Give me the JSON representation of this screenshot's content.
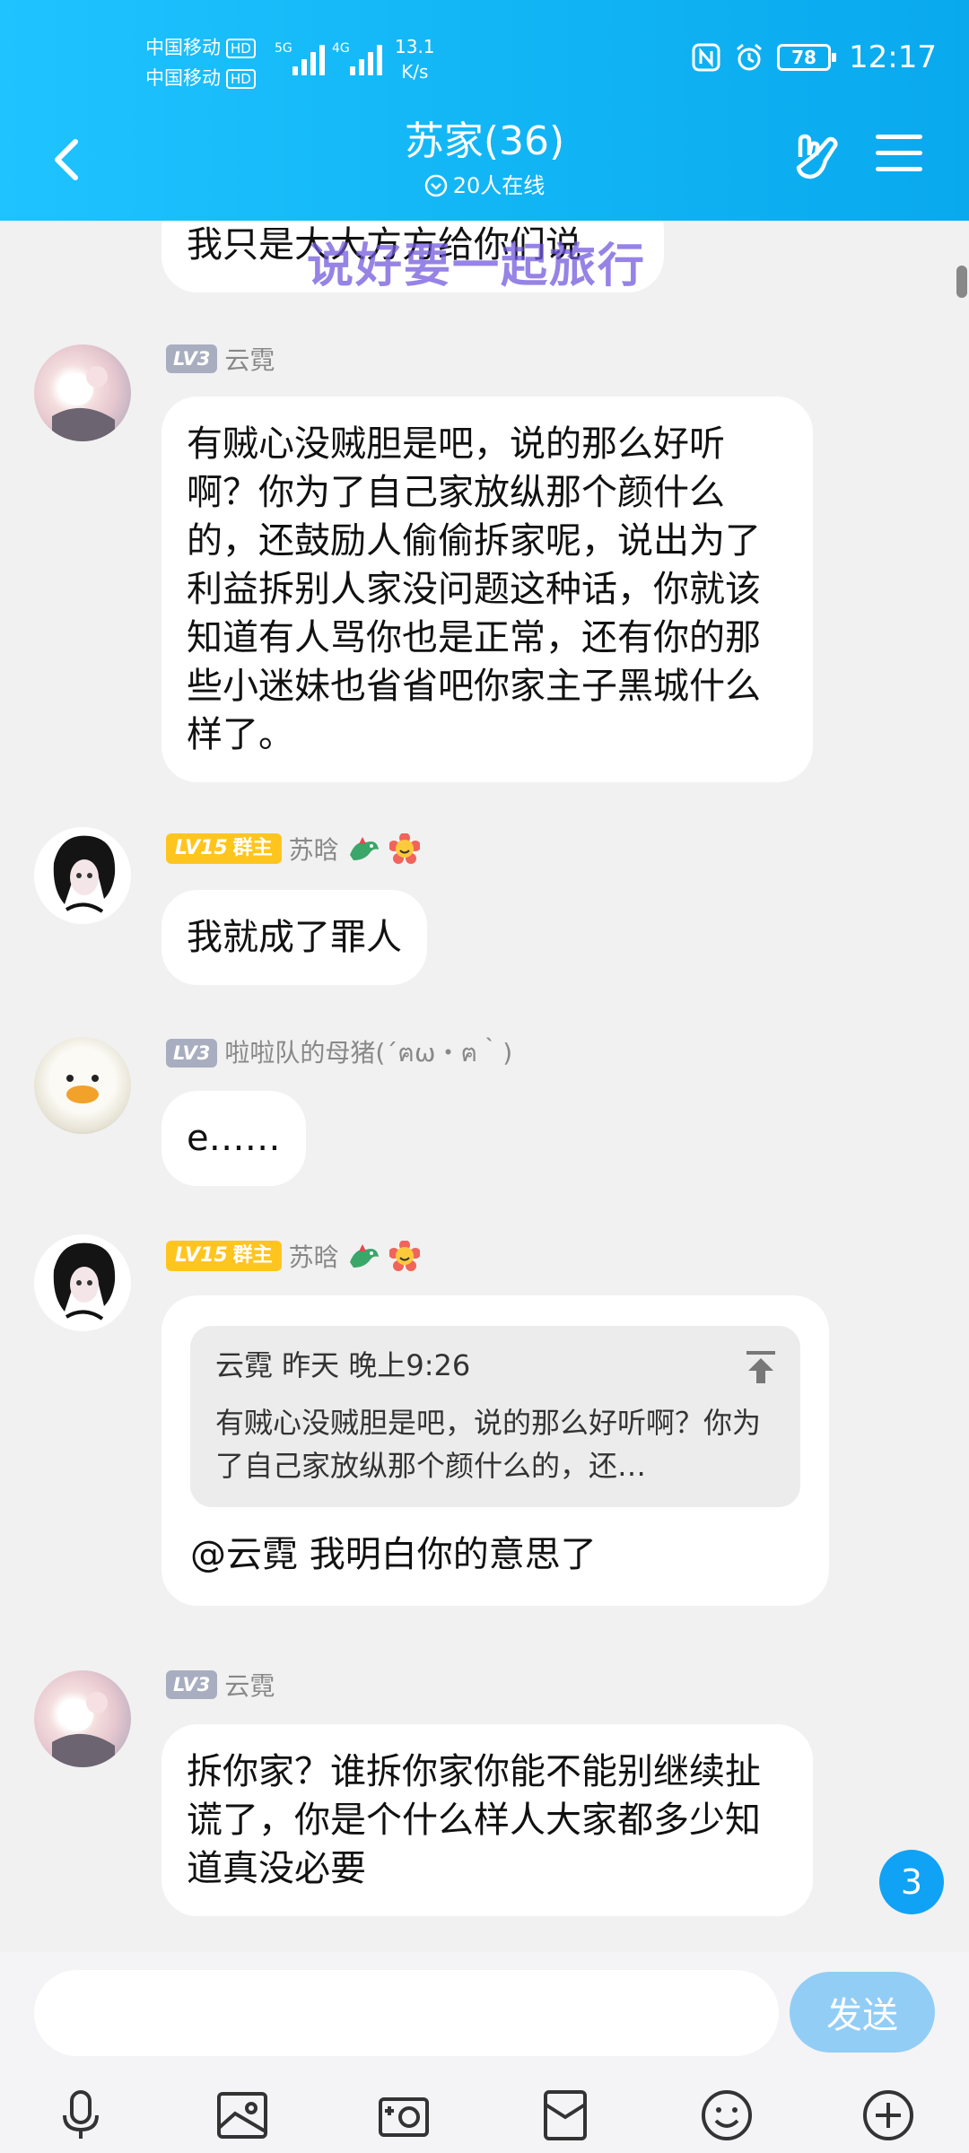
{
  "status_bar": {
    "carrier1": "中国移动",
    "carrier2": "中国移动",
    "hd": "HD",
    "net1": "5G",
    "net2": "4G",
    "speed_value": "13.1",
    "speed_unit": "K/s",
    "battery": "78",
    "time": "12:17"
  },
  "header": {
    "title": "苏家(36)",
    "online": "20人在线"
  },
  "overlay": "说好要一起旅行",
  "messages": [
    {
      "text": "我只是大大方方给你们说"
    },
    {
      "level": "LV3",
      "name": "云霓",
      "text": "有贼心没贼胆是吧，说的那么好听啊？你为了自己家放纵那个颜什么的，还鼓励人偷偷拆家呢，说出为了利益拆别人家没问题这种话，你就该知道有人骂你也是正常，还有你的那些小迷妹也省省吧你家主子黑城什么样了。"
    },
    {
      "level": "LV15",
      "role": "群主",
      "name": "苏晗",
      "text": "我就成了罪人"
    },
    {
      "level": "LV3",
      "name": "啦啦队的母猪(´ฅω・ฅ｀)",
      "text": "e……"
    },
    {
      "level": "LV15",
      "role": "群主",
      "name": "苏晗",
      "quote_head": "云霓 昨天 晚上9:26",
      "quote_body": "有贼心没贼胆是吧，说的那么好听啊？你为了自己家放纵那个颜什么的，还…",
      "text": "@云霓 我明白你的意思了"
    },
    {
      "level": "LV3",
      "name": "云霓",
      "text": "拆你家？谁拆你家你能不能别继续扯谎了，你是个什么样人大家都多少知道真没必要"
    }
  ],
  "unread_count": "3",
  "input": {
    "placeholder": "",
    "send_label": "发送"
  },
  "colors": {
    "header": "#12b6f5",
    "badge_gold": "#ffc51f",
    "badge_lv": "#a8aec0",
    "send": "#92cdf6"
  }
}
